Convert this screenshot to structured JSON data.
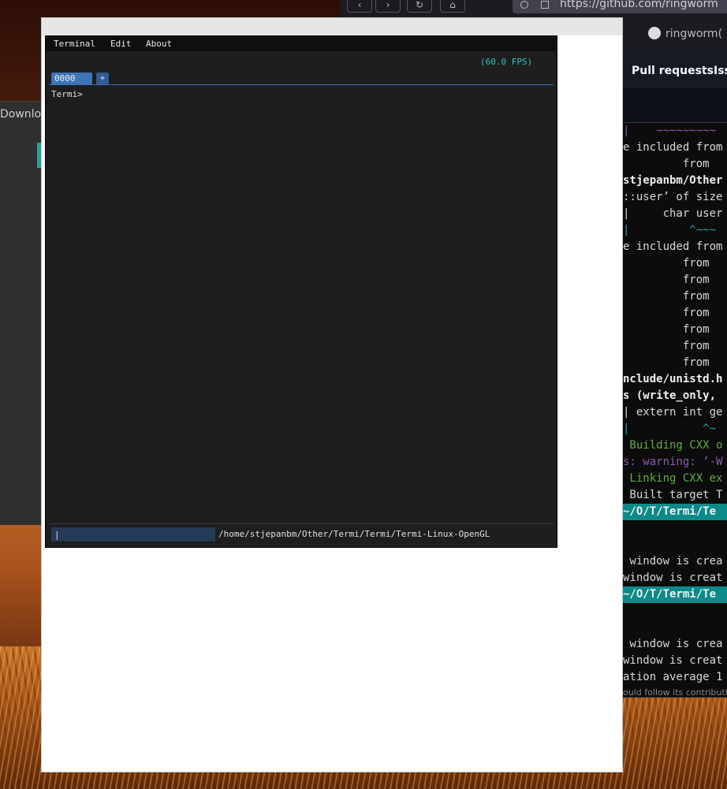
{
  "browser": {
    "url": "https://github.com/ringworm",
    "tab_title": "ringworm(",
    "nav": [
      "Pull requests",
      "Iss"
    ],
    "left_label": "Downloa"
  },
  "konsole": {
    "lines": [
      {
        "text": "|    ~~~~~~~~~",
        "cls": "purple"
      },
      {
        "text": "e included from",
        "cls": ""
      },
      {
        "text": "         from",
        "cls": ""
      },
      {
        "text": "stjepanbm/Other",
        "cls": "bold"
      },
      {
        "text": "::user’ of size",
        "cls": ""
      },
      {
        "text": "|     char user",
        "cls": ""
      },
      {
        "text": "|         ^~~~",
        "cls": "teal"
      },
      {
        "text": "e included from",
        "cls": ""
      },
      {
        "text": "         from",
        "cls": ""
      },
      {
        "text": "         from",
        "cls": ""
      },
      {
        "text": "         from",
        "cls": ""
      },
      {
        "text": "         from",
        "cls": ""
      },
      {
        "text": "         from",
        "cls": ""
      },
      {
        "text": "         from",
        "cls": ""
      },
      {
        "text": "         from",
        "cls": ""
      },
      {
        "text": "nclude/unistd.h",
        "cls": "bold"
      },
      {
        "text": "s (write_only,",
        "cls": "bold"
      },
      {
        "text": "| extern int ge",
        "cls": ""
      },
      {
        "text": "|           ^~",
        "cls": "teal"
      },
      {
        "text": " Building CXX o",
        "cls": "green"
      },
      {
        "text": "s: warning: ’-W",
        "cls": "purple"
      },
      {
        "text": " Linking CXX ex",
        "cls": "green"
      },
      {
        "text": " Built target T",
        "cls": ""
      },
      {
        "text": "~/O/T/Termi/Te",
        "cls": "prompt"
      },
      {
        "text": "",
        "cls": ""
      },
      {
        "text": "",
        "cls": ""
      },
      {
        "text": " window is crea",
        "cls": ""
      },
      {
        "text": "window is creat",
        "cls": ""
      },
      {
        "text": "~/O/T/Termi/Te",
        "cls": "prompt"
      },
      {
        "text": "",
        "cls": ""
      },
      {
        "text": "",
        "cls": ""
      },
      {
        "text": " window is crea",
        "cls": ""
      },
      {
        "text": "window is creat",
        "cls": ""
      },
      {
        "text": "ation average 1",
        "cls": ""
      }
    ],
    "footer": "ould follow its contributing"
  },
  "termi": {
    "menu": [
      "Terminal",
      "Edit",
      "About"
    ],
    "fps": "(60.0 FPS)",
    "tab_label": "0000",
    "tab_add": "+",
    "prompt": "Termi>",
    "cwd": "/home/stjepanbm/Other/Termi/Termi/Termi-Linux-OpenGL",
    "input_value": "|"
  }
}
